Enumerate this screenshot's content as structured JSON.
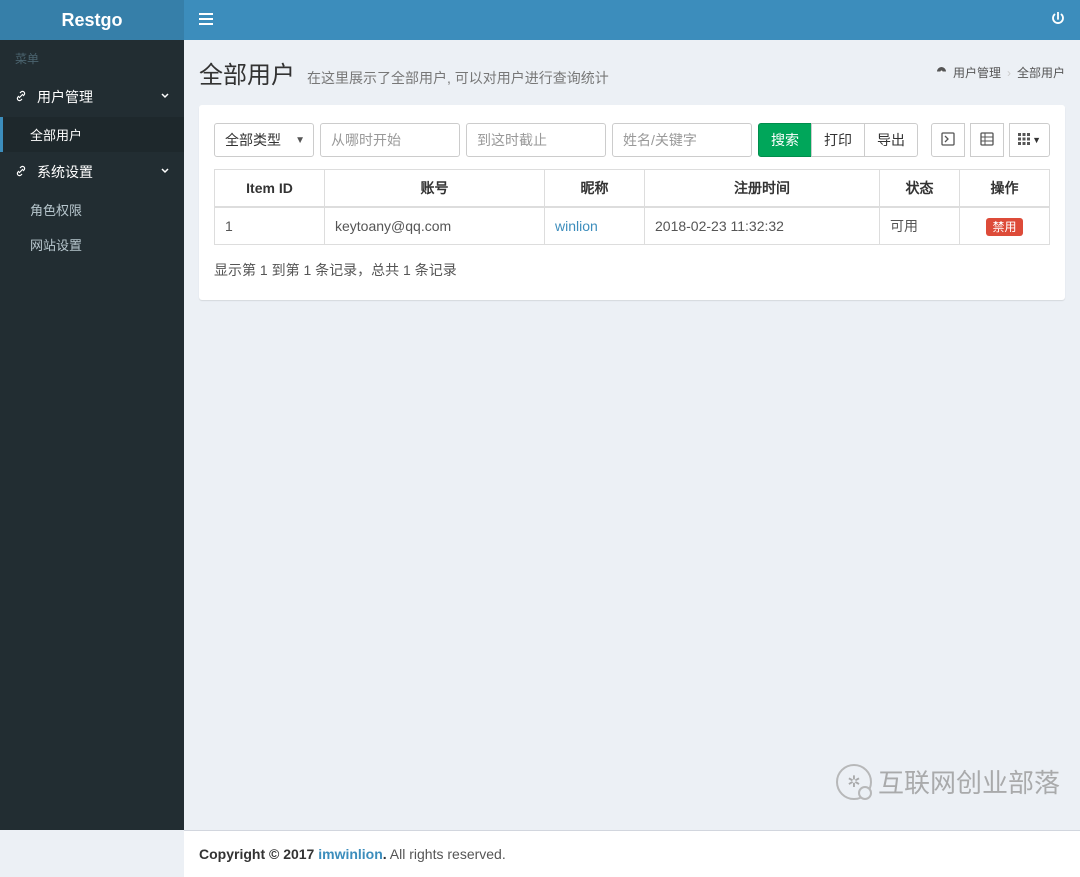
{
  "brand": "Restgo",
  "sidebar": {
    "menu_header": "菜单",
    "groups": [
      {
        "label": "用户管理",
        "icon": "link",
        "items": [
          {
            "label": "全部用户",
            "active": true
          }
        ]
      },
      {
        "label": "系统设置",
        "icon": "link",
        "items": [
          {
            "label": "角色权限",
            "active": false
          },
          {
            "label": "网站设置",
            "active": false
          }
        ]
      }
    ]
  },
  "page": {
    "title": "全部用户",
    "subtitle": "在这里展示了全部用户, 可以对用户进行查询统计",
    "breadcrumb": {
      "root": "用户管理",
      "current": "全部用户"
    }
  },
  "filters": {
    "type_selected": "全部类型",
    "start_placeholder": "从哪时开始",
    "end_placeholder": "到这时截止",
    "keyword_placeholder": "姓名/关键字",
    "search_label": "搜索",
    "print_label": "打印",
    "export_label": "导出"
  },
  "table": {
    "columns": [
      "Item ID",
      "账号",
      "昵称",
      "注册时间",
      "状态",
      "操作"
    ],
    "rows": [
      {
        "id": "1",
        "account": "keytoany@qq.com",
        "nickname": "winlion",
        "reg_time": "2018-02-23 11:32:32",
        "status": "可用",
        "action_label": "禁用"
      }
    ],
    "info": "显示第 1 到第 1 条记录，总共 1 条记录"
  },
  "footer": {
    "copyright": "Copyright © 2017 ",
    "author": "imwinlion",
    "rights": " All rights reserved."
  },
  "watermark": "互联网创业部落"
}
